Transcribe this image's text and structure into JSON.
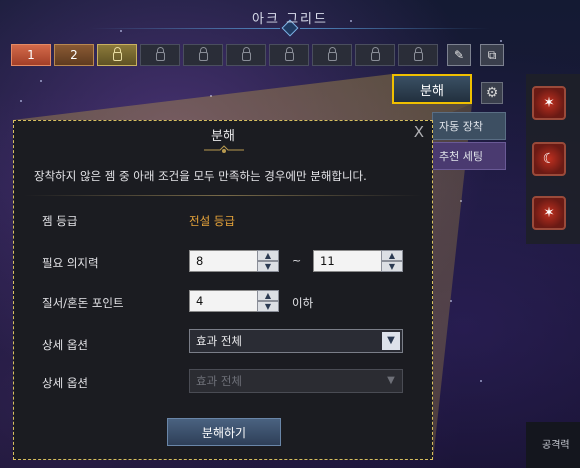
{
  "header": {
    "title": "아크 그리드"
  },
  "slots": [
    {
      "label": "1"
    },
    {
      "label": "2"
    },
    {
      "label": ""
    },
    {
      "label": ""
    },
    {
      "label": ""
    },
    {
      "label": ""
    },
    {
      "label": ""
    },
    {
      "label": ""
    },
    {
      "label": ""
    },
    {
      "label": ""
    }
  ],
  "toolbar": {
    "edit_icon": "✎",
    "copy_icon": "⧉"
  },
  "right": {
    "decompose_label": "분해",
    "auto_equip_label": "자동 장착",
    "recommend_label": "추천 세팅",
    "attack_label": "공격력"
  },
  "dialog": {
    "title": "분해",
    "close": "X",
    "description": "장착하지 않은 젬 중 아래 조건을 모두 만족하는 경우에만 분해합니다.",
    "rows": {
      "grade_label": "젬 등급",
      "grade_value": "전설 등급",
      "will_label": "필요 의지력",
      "will_min": "8",
      "will_max": "11",
      "tilde": "~",
      "point_label": "질서/혼돈 포인트",
      "point_value": "4",
      "point_suffix": "이하",
      "option1_label": "상세 옵션",
      "option1_value": "효과 전체",
      "option2_label": "상세 옵션",
      "option2_value": "효과 전체"
    },
    "action_label": "분해하기"
  },
  "colors": {
    "highlight": "#f0c000",
    "grade": "#e8a53a"
  }
}
